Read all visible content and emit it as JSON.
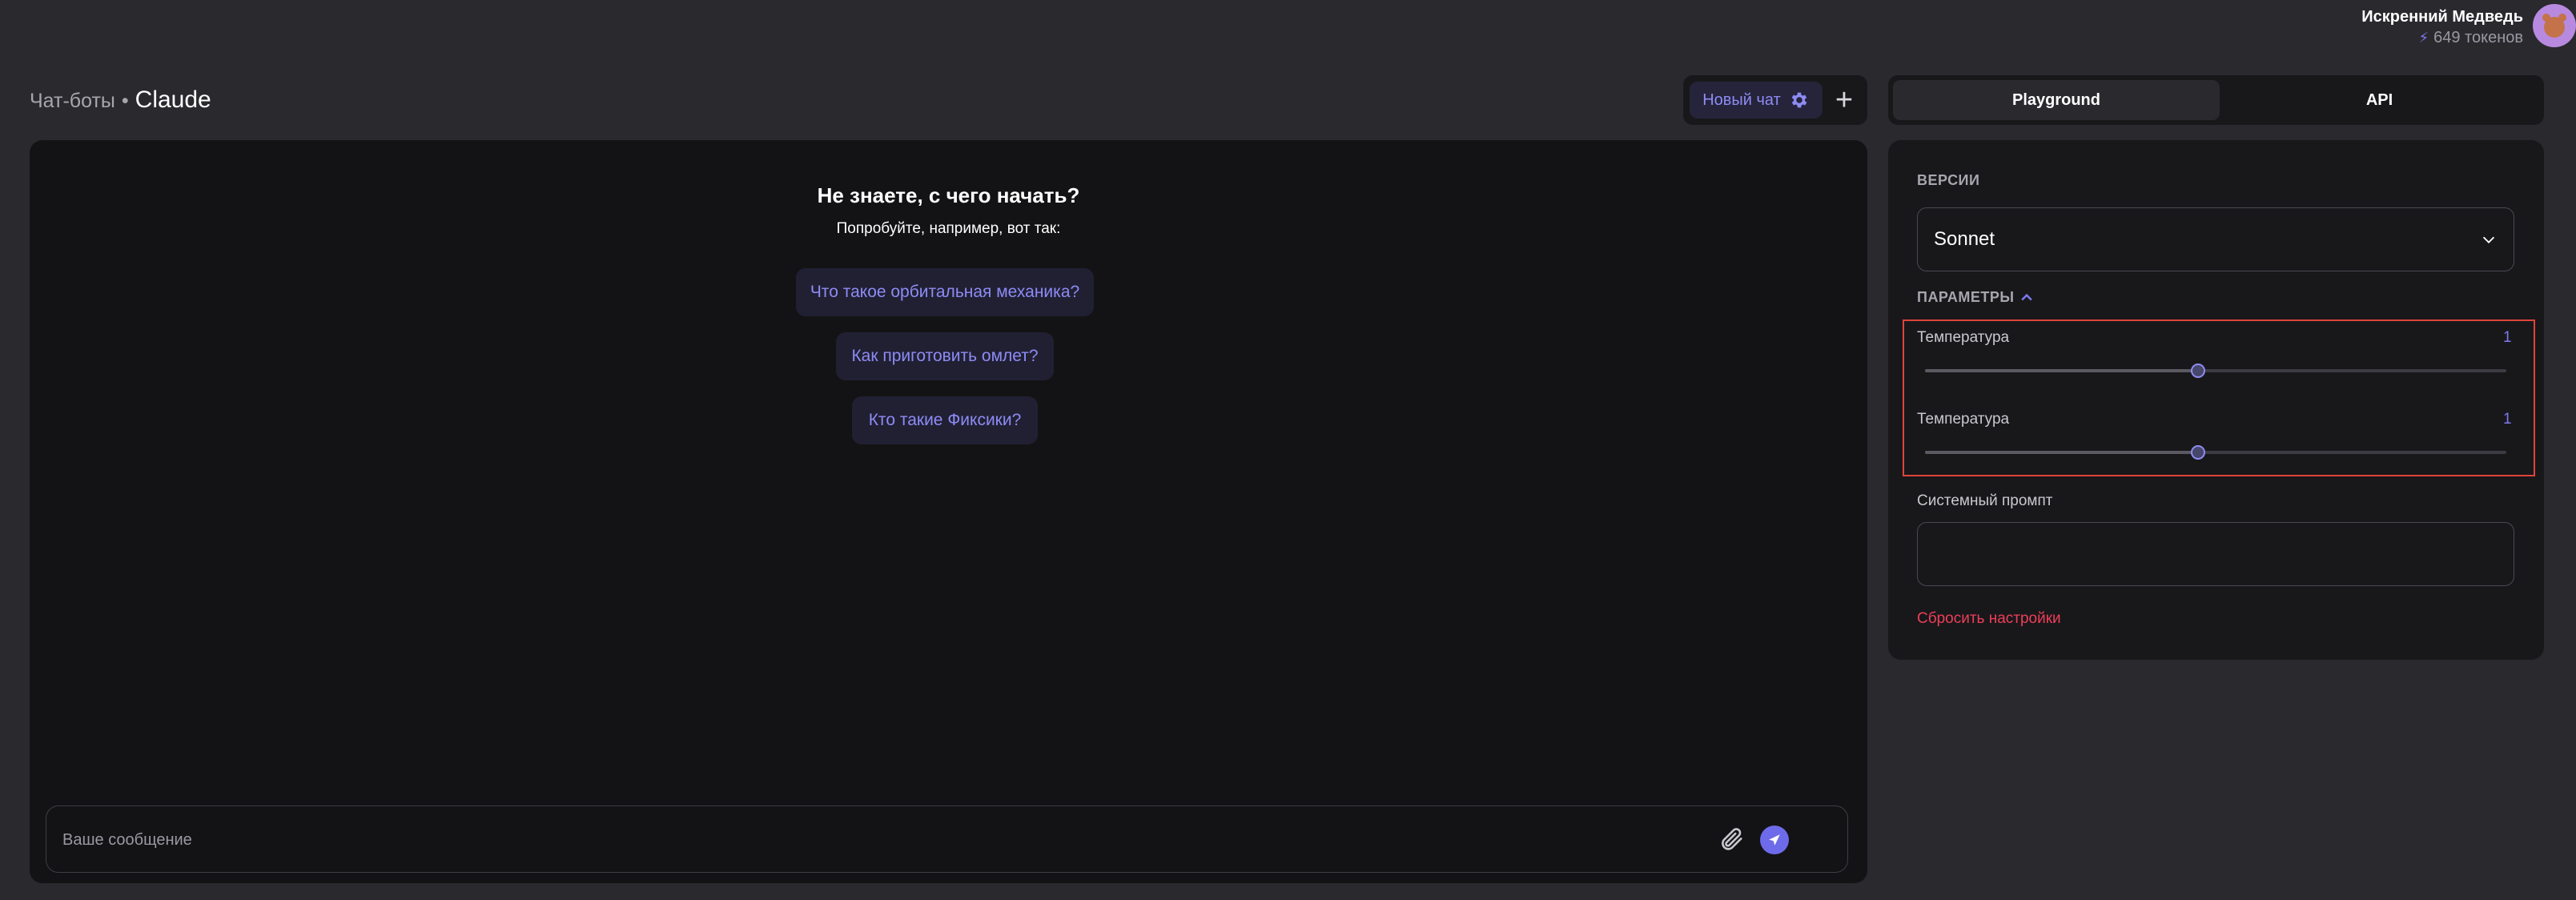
{
  "user": {
    "name": "Искренний Медведь",
    "tokens": "649 токенов",
    "bolt_icon": "bolt-icon"
  },
  "breadcrumb": {
    "parent": "Чат-боты",
    "separator": "•",
    "current": "Claude"
  },
  "chat_controls": {
    "new_chat_label": "Новый чат",
    "settings_icon": "gear-icon",
    "add_icon": "plus-icon"
  },
  "tabs": [
    {
      "label": "Playground",
      "active": true
    },
    {
      "label": "API",
      "active": false
    }
  ],
  "chat": {
    "hint_title": "Не знаете, с чего начать?",
    "hint_subtitle": "Попробуйте, например, вот так:",
    "suggestions": [
      "Что такое орбитальная механика?",
      "Как приготовить омлет?",
      "Кто такие Фиксики?"
    ],
    "message_placeholder": "Ваше сообщение",
    "attach_icon": "paperclip-icon",
    "send_icon": "send-icon"
  },
  "settings": {
    "versions_label": "ВЕРСИИ",
    "selected_version": "Sonnet",
    "params_label": "ПАРАМЕТРЫ",
    "sliders": [
      {
        "label": "Температура",
        "value": "1",
        "fraction": 0.47
      },
      {
        "label": "Температура",
        "value": "1",
        "fraction": 0.47
      }
    ],
    "system_prompt_label": "Системный промпт",
    "system_prompt_value": "",
    "reset_label": "Сбросить настройки"
  },
  "colors": {
    "accent": "#7c79f0",
    "danger": "#ee3e58",
    "highlight": "#e0433b",
    "background": "#2a292e",
    "panel": "#131315"
  }
}
